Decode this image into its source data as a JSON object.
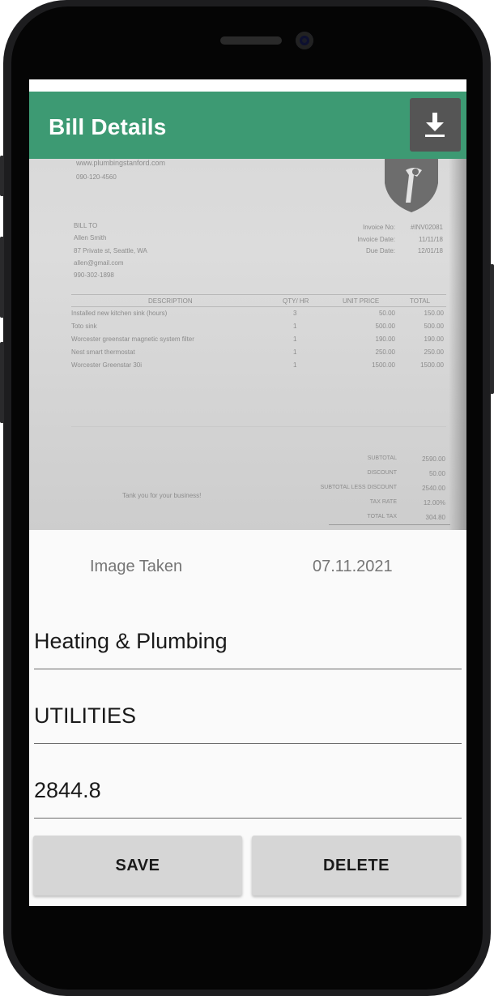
{
  "app_bar": {
    "title": "Bill Details",
    "download_icon": "download-icon",
    "color": "#3d9a73"
  },
  "invoice_image": {
    "website": "www.plumbingstanford.com",
    "phone": "090-120-4560",
    "bill_to_label": "BILL TO",
    "customer_name": "Allen Smith",
    "customer_address": "87 Private st, Seattle, WA",
    "customer_email": "allen@gmail.com",
    "customer_phone": "990-302-1898",
    "invoice_no_label": "Invoice No:",
    "invoice_no": "#INV02081",
    "invoice_date_label": "Invoice Date:",
    "invoice_date": "11/11/18",
    "due_date_label": "Due Date:",
    "due_date": "12/01/18",
    "columns": [
      "DESCRIPTION",
      "QTY/ HR",
      "UNIT PRICE",
      "TOTAL"
    ],
    "rows": [
      {
        "description": "Installed new kitchen sink (hours)",
        "qty": "3",
        "unit_price": "50.00",
        "total": "150.00"
      },
      {
        "description": "Toto sink",
        "qty": "1",
        "unit_price": "500.00",
        "total": "500.00"
      },
      {
        "description": "Worcester greenstar magnetic system filter",
        "qty": "1",
        "unit_price": "190.00",
        "total": "190.00"
      },
      {
        "description": "Nest smart thermostat",
        "qty": "1",
        "unit_price": "250.00",
        "total": "250.00"
      },
      {
        "description": "Worcester Greenstar 30i",
        "qty": "1",
        "unit_price": "1500.00",
        "total": "1500.00"
      }
    ],
    "thank_you": "Tank you for your business!",
    "totals": [
      {
        "label": "SUBTOTAL",
        "value": "2590.00"
      },
      {
        "label": "DISCOUNT",
        "value": "50.00"
      },
      {
        "label": "SUBTOTAL LESS DISCOUNT",
        "value": "2540.00"
      },
      {
        "label": "TAX RATE",
        "value": "12.00%"
      },
      {
        "label": "TOTAL TAX",
        "value": "304.80"
      }
    ]
  },
  "meta": {
    "image_taken_label": "Image Taken",
    "image_taken_date": "07.11.2021"
  },
  "fields": {
    "name": "Heating & Plumbing",
    "category": "UTILITIES",
    "amount": "2844.8"
  },
  "buttons": {
    "save": "SAVE",
    "delete": "DELETE"
  }
}
